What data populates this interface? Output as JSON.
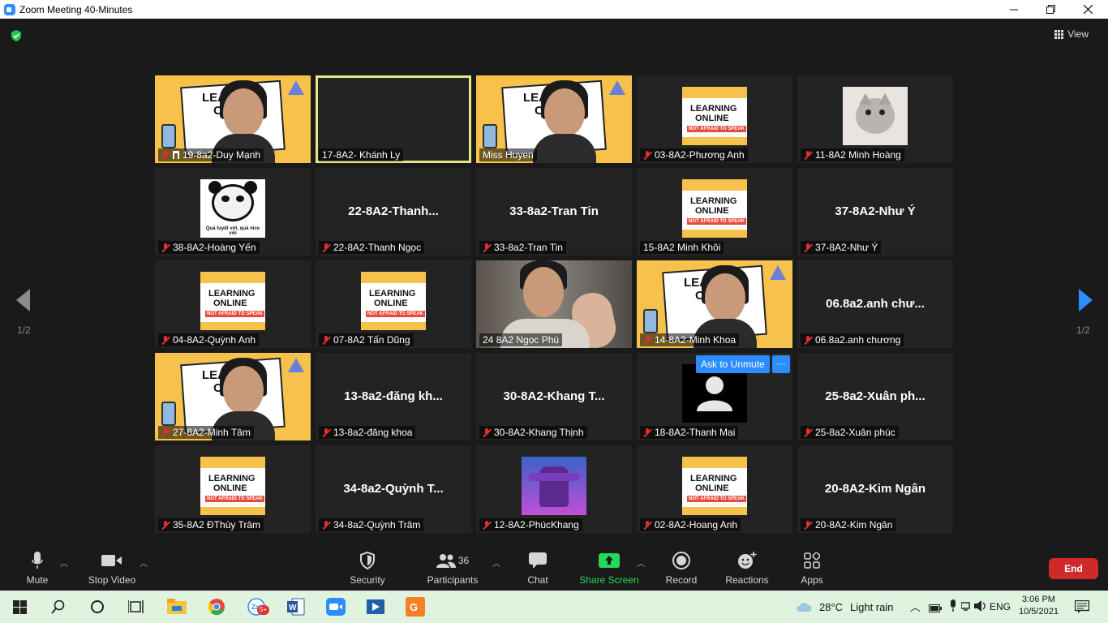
{
  "window": {
    "title": "Zoom Meeting 40-Minutes"
  },
  "header": {
    "view_label": "View"
  },
  "pagination": {
    "left": "1/2",
    "right": "1/2"
  },
  "tiles": [
    {
      "name": "19-8a2-Duy Mạnh",
      "type": "poster-face",
      "muted": true,
      "pinned": true
    },
    {
      "name": "17-8A2- Khánh Ly",
      "type": "blank",
      "muted": false,
      "active": true
    },
    {
      "name": "Miss Huyen",
      "type": "poster-face",
      "muted": false
    },
    {
      "name": "03-8A2-Phương Anh",
      "type": "poster-thumb",
      "muted": true
    },
    {
      "name": "11-8A2 Minh Hoàng",
      "type": "cat",
      "muted": true
    },
    {
      "name": "38-8A2-Hoàng Yến",
      "type": "panda",
      "muted": true,
      "meme_caption": "Quá tuyệt vời, quá nice vời"
    },
    {
      "name": "22-8A2-Thanh Ngọc",
      "type": "name",
      "big": "22-8A2-Thanh...",
      "muted": true
    },
    {
      "name": "33-8a2-Tran Tin",
      "type": "name",
      "big": "33-8a2-Tran Tin",
      "muted": true
    },
    {
      "name": "15-8A2 Minh Khôi",
      "type": "poster-thumb",
      "muted": false
    },
    {
      "name": "37-8A2-Như Ý",
      "type": "name",
      "big": "37-8A2-Như Ý",
      "muted": true
    },
    {
      "name": "04-8A2-Quỳnh Anh",
      "type": "poster-thumb",
      "muted": true
    },
    {
      "name": "07-8A2 Tấn Dũng",
      "type": "poster-thumb",
      "muted": true
    },
    {
      "name": "24 8A2 Ngọc Phú",
      "type": "video",
      "muted": false
    },
    {
      "name": "14-8A2-Minh Khoa",
      "type": "poster-face",
      "muted": true
    },
    {
      "name": "06.8a2.anh chương",
      "type": "name",
      "big": "06.8a2.anh chư...",
      "muted": true
    },
    {
      "name": "27-8A2-Minh Tâm",
      "type": "poster-face",
      "muted": true
    },
    {
      "name": "13-8a2-đăng khoa",
      "type": "name",
      "big": "13-8a2-đăng kh...",
      "muted": true
    },
    {
      "name": "30-8A2-Khang Thịnh",
      "type": "name",
      "big": "30-8A2-Khang T...",
      "muted": true
    },
    {
      "name": "18-8A2-Thanh Mai",
      "type": "avatar",
      "muted": true
    },
    {
      "name": "25-8a2-Xuân phúc",
      "type": "name",
      "big": "25-8a2-Xuân ph...",
      "muted": true
    },
    {
      "name": "35-8A2 ĐThùy Trâm",
      "type": "poster-thumb",
      "muted": true
    },
    {
      "name": "34-8a2-Quỳnh Trâm",
      "type": "name",
      "big": "34-8a2-Quỳnh T...",
      "muted": true
    },
    {
      "name": "12-8A2-PhúcKhang",
      "type": "game",
      "muted": true
    },
    {
      "name": "02-8A2-Hoang Anh",
      "type": "poster-thumb",
      "muted": true
    },
    {
      "name": "20-8A2-Kim Ngân",
      "type": "name",
      "big": "20-8A2-Kim Ngân",
      "muted": true
    }
  ],
  "poster": {
    "line1": "LEARNING",
    "line2": "ONLINE",
    "line3": "NOT AFRAID TO SPEAK"
  },
  "hover_controls": {
    "ask_to_unmute": "Ask to Unmute",
    "more": "···"
  },
  "toolbar": {
    "mute": "Mute",
    "stop_video": "Stop Video",
    "security": "Security",
    "participants": "Participants",
    "participants_count": "36",
    "chat": "Chat",
    "share_screen": "Share Screen",
    "record": "Record",
    "reactions": "Reactions",
    "apps": "Apps",
    "end": "End"
  },
  "taskbar": {
    "weather_temp": "28°C",
    "weather_text": "Light rain",
    "language": "ENG",
    "time": "3:06 PM",
    "date": "10/5/2021",
    "zalo_badge": "5+"
  },
  "colors": {
    "accent": "#2d8cff",
    "share_green": "#23d959",
    "end_red": "#cf2a2a",
    "muted_red": "#e0312f",
    "active_border": "#e6e68a",
    "poster_yellow": "#f6c24b"
  }
}
